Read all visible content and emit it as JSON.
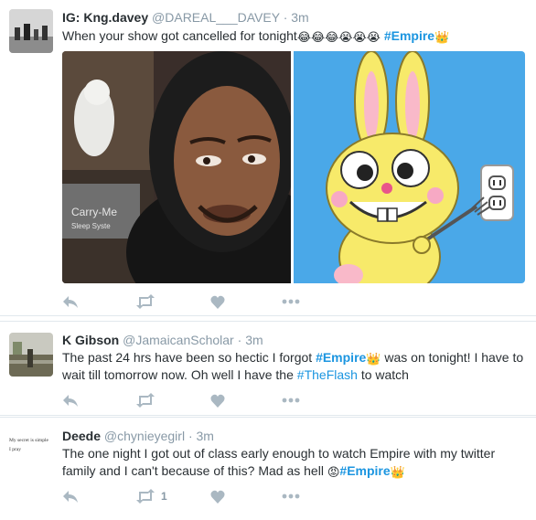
{
  "tweets": [
    {
      "name": "IG: Kng.davey",
      "handle": "@DAREAL___DAVEY",
      "separator": "·",
      "time": "3m",
      "text": "When your show got cancelled for tonight",
      "emojis": "😂😂😂😭😭😭",
      "hashtag": "#Empire",
      "crown": "👑",
      "retweet_count": ""
    },
    {
      "name": "K Gibson",
      "handle": "@JamaicanScholar",
      "separator": "·",
      "time": "3m",
      "text_a": "The past 24 hrs have been so hectic I forgot ",
      "hashtag": "#Empire",
      "crown": "👑",
      "text_b": " was on tonight! I have to wait till tomorrow now. Oh well I have the ",
      "hashtag2": "#TheFlash",
      "text_c": " to watch",
      "retweet_count": ""
    },
    {
      "name": "Deede",
      "handle": "@chynieyegirl",
      "separator": "·",
      "time": "3m",
      "text_a": "The one night I got out of class early enough to watch Empire with my twitter family and I can't because of this? Mad as hell ",
      "angry": "😡",
      "hashtag": "#Empire",
      "crown": "👑",
      "retweet_count": "1",
      "avatar_text_1": "My secret is simple",
      "avatar_text_2": "I pray"
    }
  ],
  "media_text": {
    "sign_line_1": "Carry-Me",
    "sign_line_2": "Sleep Syste"
  },
  "colors": {
    "hashtag": "#1b95e0",
    "muted": "#8899a6",
    "text": "#292f33",
    "divider": "#e1e8ed",
    "icon": "#aab8c2",
    "bunny_bg": "#4aa8e8",
    "bunny_yellow": "#f7ea6a"
  },
  "icons": [
    "reply-icon",
    "retweet-icon",
    "like-icon",
    "more-icon"
  ]
}
